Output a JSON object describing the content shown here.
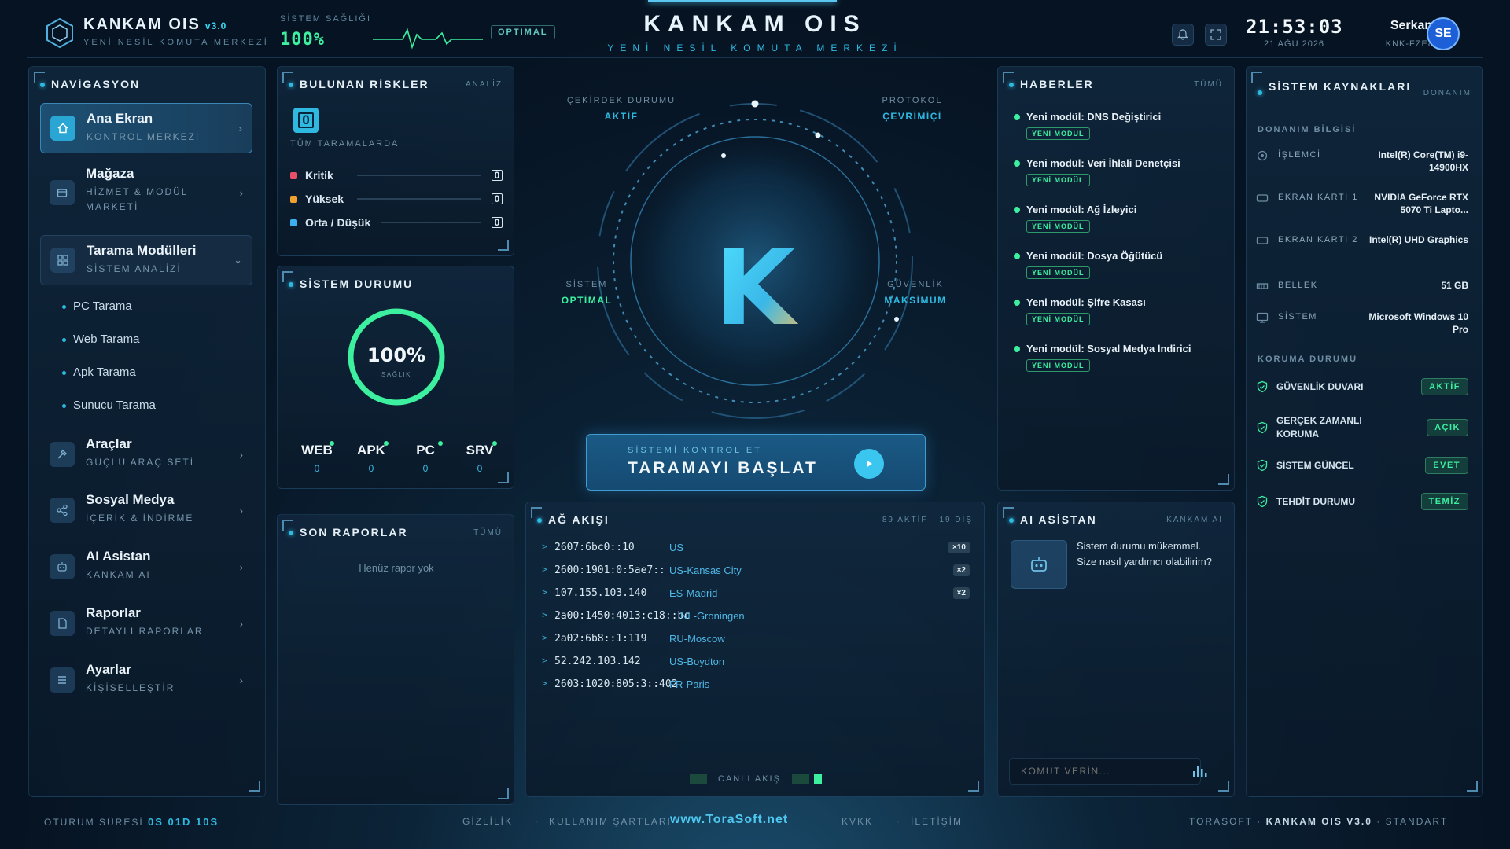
{
  "header": {
    "brand": "KANKAM OIS",
    "version": "v3.0",
    "brand_sub": "YENİ NESİL KOMUTA MERKEZİ",
    "health_label": "SİSTEM SAĞLIĞI",
    "health_value": "100%",
    "status_badge": "OPTIMAL",
    "title": "KANKAM OIS",
    "subtitle": "YENİ NESİL KOMUTA MERKEZİ",
    "time": "21:53:03",
    "date": "21 AĞU 2026",
    "user": "Serkanka",
    "user_id": "KNK-FZE8TB",
    "avatar": "SE"
  },
  "nav": {
    "title": "NAVİGASYON",
    "items": [
      {
        "label": "Ana Ekran",
        "sub": "KONTROL MERKEZİ",
        "icon": "home-icon"
      },
      {
        "label": "Mağaza",
        "sub": "HİZMET & MODÜL MARKETİ",
        "icon": "store-icon"
      },
      {
        "label": "Tarama Modülleri",
        "sub": "SİSTEM ANALİZİ",
        "icon": "grid-icon"
      },
      {
        "label": "Araçlar",
        "sub": "GÜÇLÜ ARAÇ SETİ",
        "icon": "tools-icon"
      },
      {
        "label": "Sosyal Medya",
        "sub": "İÇERİK & İNDİRME",
        "icon": "share-icon"
      },
      {
        "label": "AI Asistan",
        "sub": "KANKAM AI",
        "icon": "robot-icon"
      },
      {
        "label": "Raporlar",
        "sub": "DETAYLI RAPORLAR",
        "icon": "file-icon"
      },
      {
        "label": "Ayarlar",
        "sub": "KİŞİSELLEŞTİR",
        "icon": "menu-icon"
      }
    ],
    "sub_items": [
      "PC Tarama",
      "Web Tarama",
      "Apk Tarama",
      "Sunucu Tarama"
    ]
  },
  "risks": {
    "title": "BULUNAN RİSKLER",
    "action": "ANALİZ",
    "total": "0",
    "caption": "TÜM TARAMALARDA",
    "rows": [
      {
        "label": "Kritik",
        "value": "0",
        "color": "#e8506a"
      },
      {
        "label": "Yüksek",
        "value": "0",
        "color": "#f0a030"
      },
      {
        "label": "Orta / Düşük",
        "value": "0",
        "color": "#3ab0f0"
      }
    ]
  },
  "status": {
    "title": "SİSTEM DURUMU",
    "value": "100%",
    "caption": "SAĞLIK",
    "fill": 1.0,
    "metrics": [
      {
        "label": "WEB",
        "value": "0"
      },
      {
        "label": "APK",
        "value": "0"
      },
      {
        "label": "PC",
        "value": "0"
      },
      {
        "label": "SRV",
        "value": "0"
      }
    ]
  },
  "reports": {
    "title": "SON RAPORLAR",
    "action": "TÜMÜ",
    "empty": "Henüz rapor yok"
  },
  "core": {
    "letter": "K",
    "top_left": {
      "label": "ÇEKİRDEK DURUMU",
      "value": "AKTİF"
    },
    "top_right": {
      "label": "PROTOKOL",
      "value": "ÇEVRİMİÇİ"
    },
    "mid_left": {
      "label": "SİSTEM",
      "value": "OPTİMAL"
    },
    "mid_right": {
      "label": "GÜVENLİK",
      "value": "MAKSİMUM"
    },
    "button_sub": "SİSTEMİ KONTROL ET",
    "button_main": "TARAMAYI BAŞLAT"
  },
  "network": {
    "title": "AĞ AKIŞI",
    "stats": "89 AKTİF · 19 DIŞ",
    "live": "CANLI AKIŞ",
    "rows": [
      {
        "ip": "2607:6bc0::10",
        "loc": "US",
        "count": "×10"
      },
      {
        "ip": "2600:1901:0:5ae7::",
        "loc": "US-Kansas City",
        "count": "×2"
      },
      {
        "ip": "107.155.103.140",
        "loc": "ES-Madrid",
        "count": "×2"
      },
      {
        "ip": "2a00:1450:4013:c18::bc",
        "loc": "NL-Groningen",
        "count": ""
      },
      {
        "ip": "2a02:6b8::1:119",
        "loc": "RU-Moscow",
        "count": ""
      },
      {
        "ip": "52.242.103.142",
        "loc": "US-Boydton",
        "count": ""
      },
      {
        "ip": "2603:1020:805:3::402",
        "loc": "FR-Paris",
        "count": ""
      }
    ]
  },
  "news": {
    "title": "HABERLER",
    "action": "TÜMÜ",
    "tag": "YENİ MODÜL",
    "items": [
      "Yeni modül: DNS Değiştirici",
      "Yeni modül: Veri İhlali Denetçisi",
      "Yeni modül: Ağ İzleyici",
      "Yeni modül: Dosya Öğütücü",
      "Yeni modül: Şifre Kasası",
      "Yeni modül: Sosyal Medya İndirici"
    ]
  },
  "ai": {
    "title": "AI ASİSTAN",
    "brand": "KANKAM AI",
    "message": "Sistem durumu mükemmel. Size nasıl yardımcı olabilirim?",
    "placeholder": "KOMUT VERİN..."
  },
  "resources": {
    "title": "SİSTEM KAYNAKLARI",
    "action": "DONANIM",
    "hw_section": "DONANIM BİLGİSİ",
    "prot_section": "KORUMA DURUMU",
    "hw": [
      {
        "label": "İŞLEMCİ",
        "value": "Intel(R) Core(TM) i9-14900HX",
        "icon": "cpu-icon"
      },
      {
        "label": "EKRAN KARTI 1",
        "value": "NVIDIA GeForce RTX 5070 Ti Lapto...",
        "icon": "gpu-icon"
      },
      {
        "label": "EKRAN KARTI 2",
        "value": "Intel(R) UHD Graphics",
        "icon": "gpu-icon"
      },
      {
        "label": "BELLEK",
        "value": "51 GB",
        "icon": "memory-icon"
      },
      {
        "label": "SİSTEM",
        "value": "Microsoft Windows 10 Pro",
        "icon": "monitor-icon"
      }
    ],
    "protection": [
      {
        "label": "GÜVENLİK DUVARI",
        "value": "AKTİF"
      },
      {
        "label": "GERÇEK ZAMANLI KORUMA",
        "value": "AÇIK"
      },
      {
        "label": "SİSTEM GÜNCEL",
        "value": "EVET"
      },
      {
        "label": "TEHDİT DURUMU",
        "value": "TEMİZ"
      }
    ]
  },
  "footer": {
    "session_label": "OTURUM SÜRESİ",
    "session_value": "0S 01D 10S",
    "links": [
      "GİZLİLİK",
      "KULLANIM ŞARTLARI",
      "KVKK",
      "İLETİŞİM"
    ],
    "site": "www.ToraSoft.net",
    "right": "TORASOFT · ",
    "product": "KANKAM OIS V3.0",
    "edition": " · STANDART"
  },
  "colors": {
    "accent": "#2fb9e0",
    "success": "#3cf0a0",
    "bg": "#061322"
  }
}
